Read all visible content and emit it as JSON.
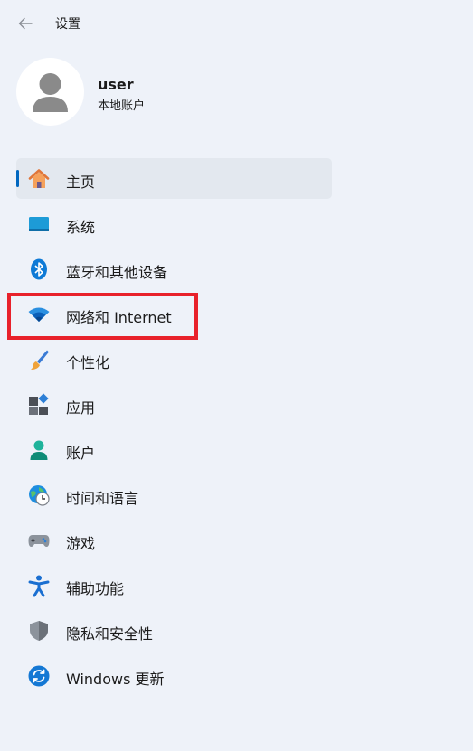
{
  "titlebar": {
    "title": "设置",
    "back_icon": "back-arrow-icon"
  },
  "profile": {
    "name": "user",
    "account_type": "本地账户"
  },
  "nav": {
    "selected_index": 0,
    "items": [
      {
        "label": "主页",
        "icon": "home-icon"
      },
      {
        "label": "系统",
        "icon": "system-display-icon"
      },
      {
        "label": "蓝牙和其他设备",
        "icon": "bluetooth-icon"
      },
      {
        "label": "网络和 Internet",
        "icon": "wifi-icon"
      },
      {
        "label": "个性化",
        "icon": "paintbrush-icon"
      },
      {
        "label": "应用",
        "icon": "apps-icon"
      },
      {
        "label": "账户",
        "icon": "account-icon"
      },
      {
        "label": "时间和语言",
        "icon": "globe-clock-icon"
      },
      {
        "label": "游戏",
        "icon": "gamepad-icon"
      },
      {
        "label": "辅助功能",
        "icon": "accessibility-icon"
      },
      {
        "label": "隐私和安全性",
        "icon": "shield-icon"
      },
      {
        "label": "Windows 更新",
        "icon": "windows-update-icon"
      }
    ]
  },
  "colors": {
    "background": "#eef2f9",
    "selected_item": "#e3e8ef",
    "accent": "#0067c0",
    "highlight_border": "#e8212b"
  }
}
